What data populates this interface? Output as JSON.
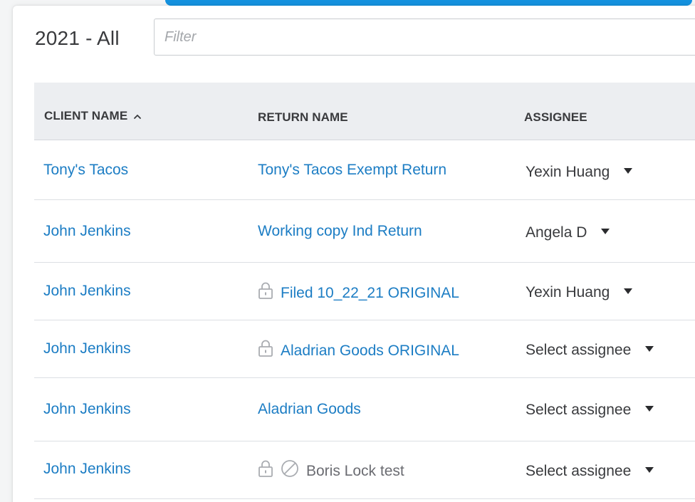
{
  "header": {
    "period_title": "2021 - All",
    "filter_placeholder": "Filter",
    "filter_value": ""
  },
  "colors": {
    "accent": "#1592df",
    "link": "#1c7dc4",
    "header_bg": "#eceef1",
    "text": "#393a3d",
    "muted": "#6b6c72"
  },
  "table": {
    "columns": {
      "client_name": "CLIENT NAME",
      "return_name": "RETURN NAME",
      "assignee": "ASSIGNEE"
    },
    "sort": {
      "column": "client_name",
      "direction": "ascending",
      "icon": "chevron-up-icon"
    },
    "rows": [
      {
        "client": "Tony's Tacos",
        "return_name": "Tony's Tacos Exempt Return",
        "locked": false,
        "blocked": false,
        "assignee": "Yexin Huang"
      },
      {
        "client": "John Jenkins",
        "return_name": "Working copy Ind Return",
        "locked": false,
        "blocked": false,
        "assignee": "Angela D"
      },
      {
        "client": "John Jenkins",
        "return_name": "Filed 10_22_21 ORIGINAL",
        "locked": true,
        "blocked": false,
        "assignee": "Yexin Huang"
      },
      {
        "client": "John Jenkins",
        "return_name": "Aladrian Goods ORIGINAL",
        "locked": true,
        "blocked": false,
        "assignee": "Select assignee"
      },
      {
        "client": "John Jenkins",
        "return_name": "Aladrian Goods",
        "locked": false,
        "blocked": false,
        "assignee": "Select assignee"
      },
      {
        "client": "John Jenkins",
        "return_name": "Boris Lock test",
        "locked": true,
        "blocked": true,
        "assignee": "Select assignee"
      }
    ]
  }
}
